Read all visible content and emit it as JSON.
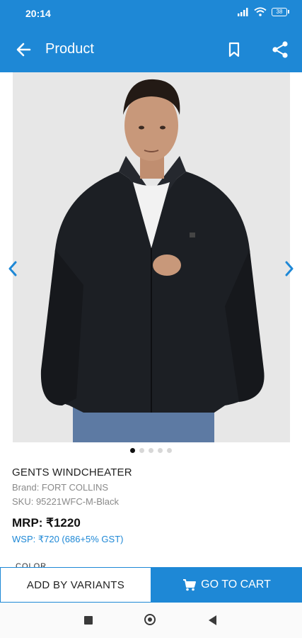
{
  "status_bar": {
    "time": "20:14",
    "battery": "38"
  },
  "app_bar": {
    "title": "Product"
  },
  "product": {
    "name": "GENTS WINDCHEATER",
    "brand": "Brand: FORT COLLINS",
    "sku": "SKU: 95221WFC-M-Black",
    "mrp": "MRP: ₹1220",
    "wsp": "WSP: ₹720 (686+5% GST)",
    "section_label": "COLOR"
  },
  "gallery": {
    "image_count": 5,
    "active_index": 0
  },
  "actions": {
    "variants_label": "ADD BY VARIANTS",
    "cart_label": "GO TO CART"
  },
  "colors": {
    "primary": "#1e88d6",
    "jacket": "#1c1f24",
    "background": "#e7e7e7"
  }
}
